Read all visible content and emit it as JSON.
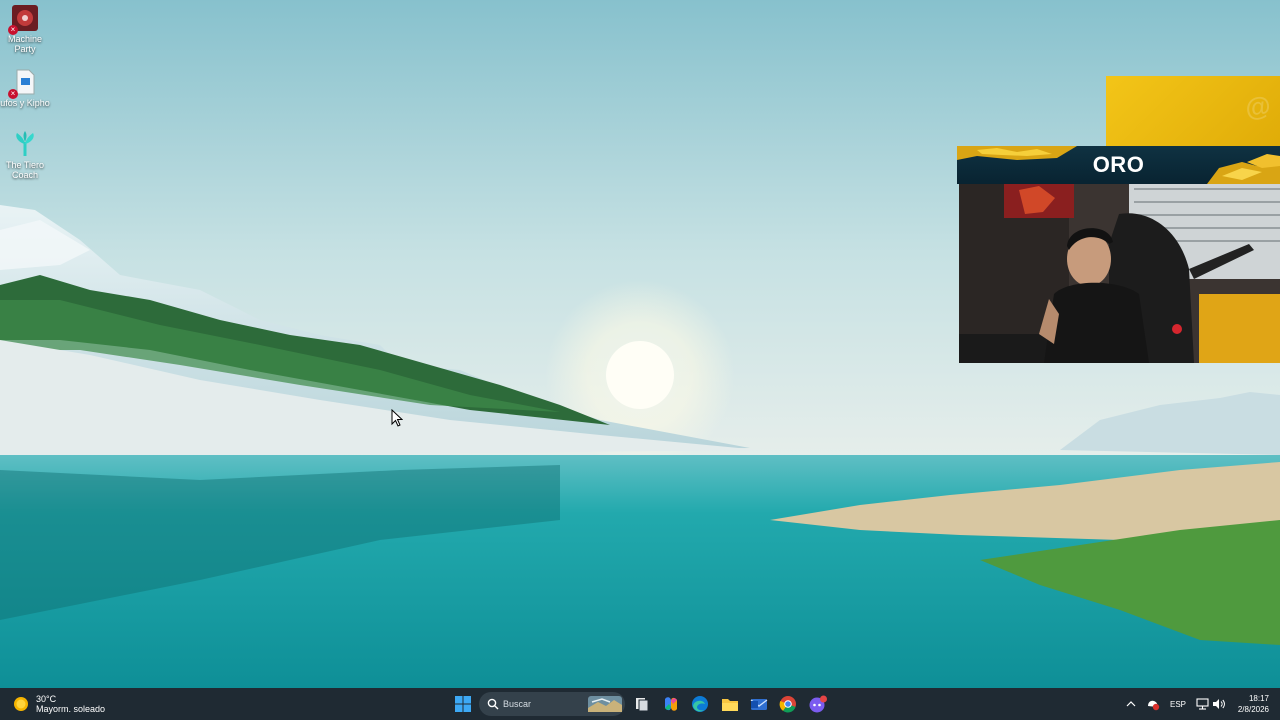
{
  "desktop": {
    "icons": [
      {
        "label": "Machine Party",
        "icon": "machine-party-app-icon"
      },
      {
        "label": "ufos y Kipho",
        "icon": "document-shortcut-icon"
      },
      {
        "label": "The Tiero Coach",
        "icon": "plant-app-icon"
      }
    ]
  },
  "overlay": {
    "watermark": "@",
    "banner_title": "ORO",
    "webcam": "streamer-webcam-feed"
  },
  "taskbar": {
    "weather": {
      "temp": "30°C",
      "condition": "Mayorm. soleado",
      "icon": "sun-weather-icon"
    },
    "search": {
      "placeholder": "Buscar"
    },
    "apps": [
      "start-icon",
      "search-icon",
      "task-view-icon",
      "copilot-icon",
      "edge-icon",
      "file-explorer-icon",
      "mail-icon",
      "chrome-icon",
      "discord-icon"
    ],
    "tray": {
      "language": "ESP",
      "time": "18:17",
      "date": "2/8/2026"
    }
  },
  "colors": {
    "sky_top": "#8fc5d0",
    "lake": "#1aa3a8",
    "taskbar": "#1f2a33",
    "gold": "#f3c518",
    "banner": "#0f3242"
  }
}
